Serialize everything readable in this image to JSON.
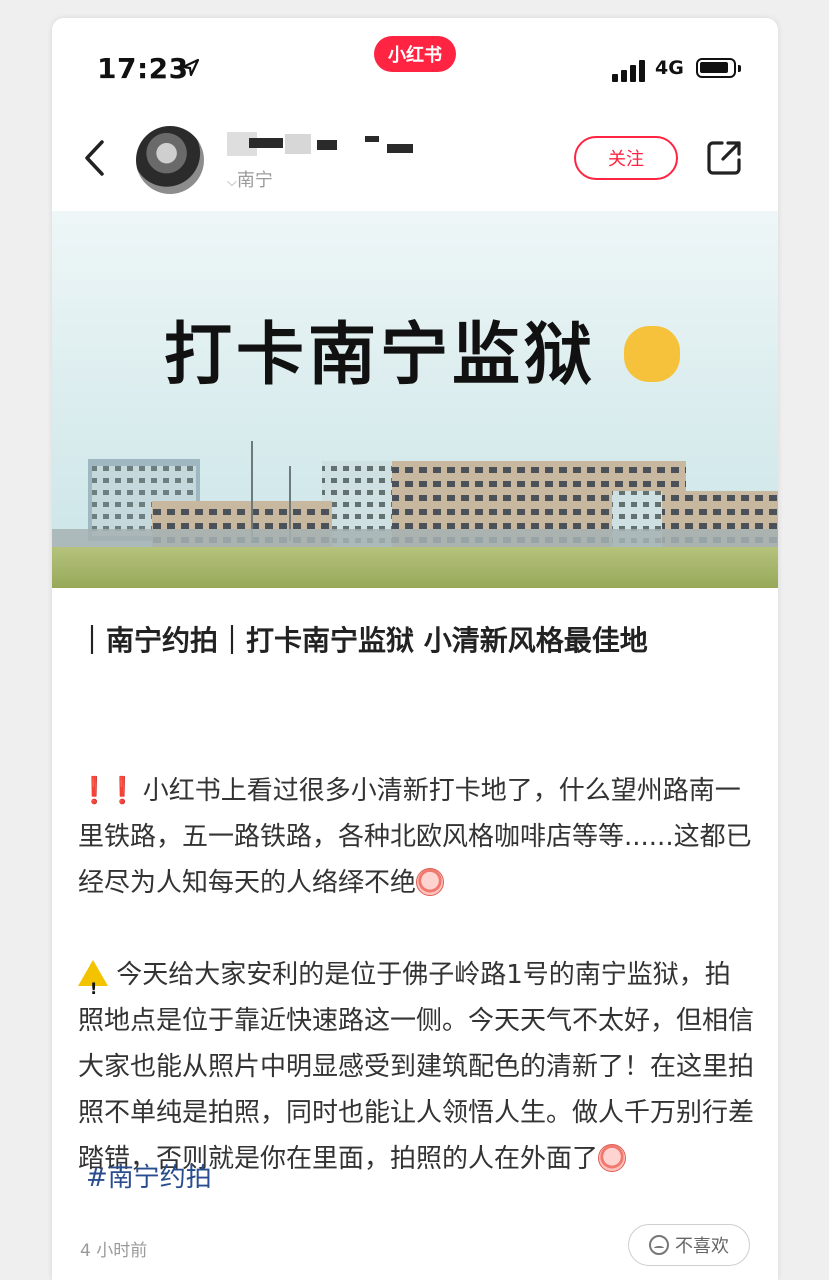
{
  "app": {
    "badge_label": "小红书",
    "accent_color": "#ff2442"
  },
  "status_bar": {
    "time": "17:23",
    "network": "4G"
  },
  "header": {
    "location": "南宁",
    "follow_label": "关注",
    "icons": [
      "chevron-left-icon",
      "share-icon"
    ]
  },
  "hero": {
    "title": "打卡南宁监狱"
  },
  "post": {
    "title": "｜南宁约拍｜打卡南宁监狱 小清新风格最佳地",
    "p1": "小红书上看过很多小清新打卡地了，什么望州路南一里铁路，五一路铁路，各种北欧风格咖啡店等等......这都已经尽为人知每天的人络绎不绝",
    "p2": "今天给大家安利的是位于佛子岭路1号的南宁监狱，拍照地点是位于靠近快速路这一侧。今天天气不太好，但相信大家也能从照片中明显感受到建筑配色的清新了！在这里拍照不单纯是拍照，同时也能让人领悟人生。做人千万别行差踏错，否则就是你在里面，拍照的人在外面了",
    "hashtag": "#南宁约拍",
    "time_ago": "4 小时前",
    "dislike_label": "不喜欢"
  }
}
